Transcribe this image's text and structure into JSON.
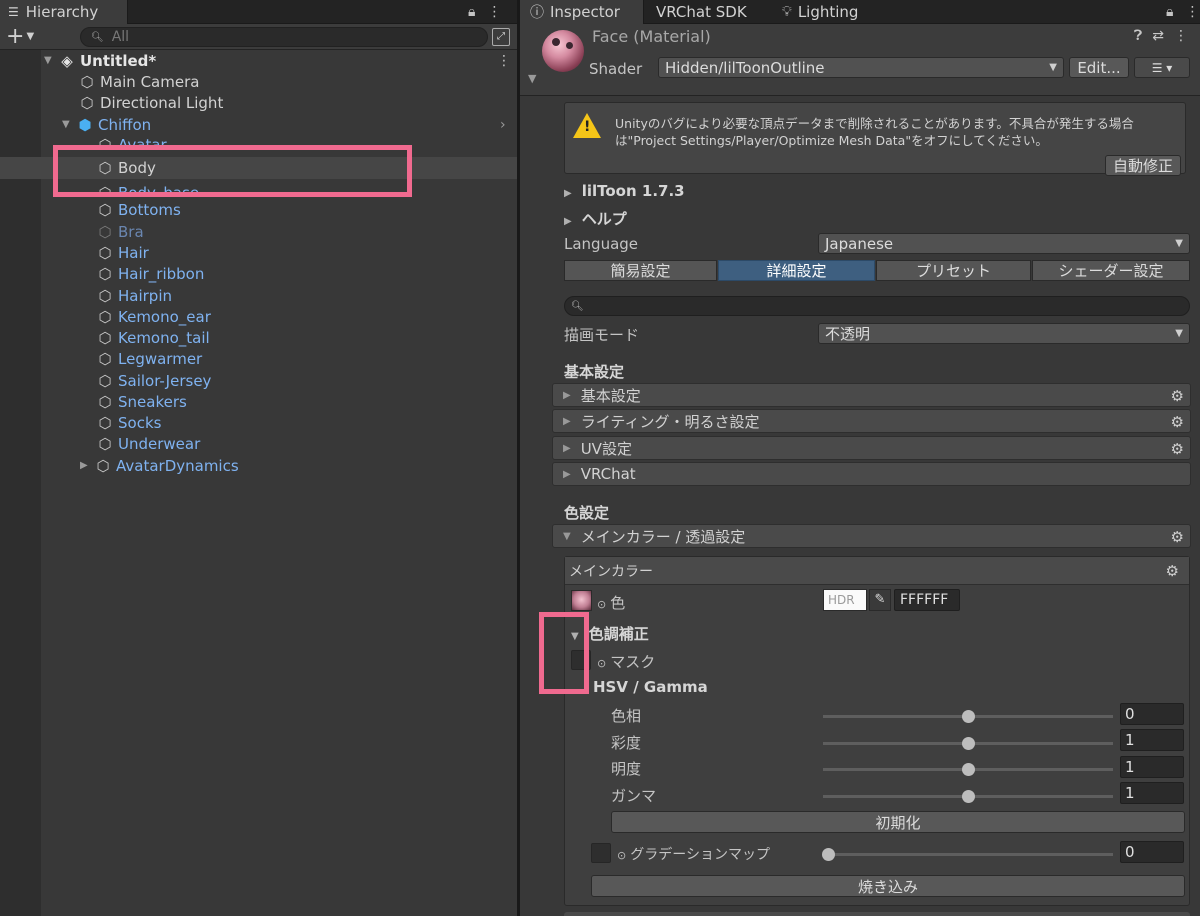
{
  "hierarchy": {
    "tab_label": "Hierarchy",
    "search_placeholder": "All",
    "scene_name": "Untitled*",
    "items": [
      {
        "label": "Main Camera"
      },
      {
        "label": "Directional Light"
      },
      {
        "label": "Chiffon"
      },
      {
        "label": "Avatar"
      },
      {
        "label": "Body"
      },
      {
        "label": "Body_base"
      },
      {
        "label": "Bottoms"
      },
      {
        "label": "Bra"
      },
      {
        "label": "Hair"
      },
      {
        "label": "Hair_ribbon"
      },
      {
        "label": "Hairpin"
      },
      {
        "label": "Kemono_ear"
      },
      {
        "label": "Kemono_tail"
      },
      {
        "label": "Legwarmer"
      },
      {
        "label": "Sailor-Jersey"
      },
      {
        "label": "Sneakers"
      },
      {
        "label": "Socks"
      },
      {
        "label": "Underwear"
      },
      {
        "label": "AvatarDynamics"
      }
    ]
  },
  "inspector": {
    "tabs": [
      {
        "label": "Inspector"
      },
      {
        "label": "VRChat SDK"
      },
      {
        "label": "Lighting"
      }
    ],
    "material_title": "Face (Material)",
    "shader_label": "Shader",
    "shader_value": "Hidden/lilToonOutline",
    "edit_button": "Edit...",
    "warning_text": "Unityのバグにより必要な頂点データまで削除されることがあります。不具合が発生する場合は\"Project Settings/Player/Optimize Mesh Data\"をオフにしてください。",
    "auto_fix_button": "自動修正",
    "version_label": "lilToon 1.7.3",
    "help_label": "ヘルプ",
    "language_label": "Language",
    "language_value": "Japanese",
    "mode_tabs": [
      "簡易設定",
      "詳細設定",
      "プリセット",
      "シェーダー設定"
    ],
    "render_mode_label": "描画モード",
    "render_mode_value": "不透明",
    "basic_section_title": "基本設定",
    "basic_foldouts": [
      "基本設定",
      "ライティング・明るさ設定",
      "UV設定",
      "VRChat"
    ],
    "color_section_title": "色設定",
    "main_color_foldout": "メインカラー / 透過設定",
    "main_color_box_title": "メインカラー",
    "color_label": "色",
    "hdr_label": "HDR",
    "hex_value": "FFFFFF",
    "color_correction_label": "色調補正",
    "mask_label": "マスク",
    "hsv_gamma_label": "HSV / Gamma",
    "sliders": [
      {
        "label": "色相",
        "value": "0"
      },
      {
        "label": "彩度",
        "value": "1"
      },
      {
        "label": "明度",
        "value": "1"
      },
      {
        "label": "ガンマ",
        "value": "1"
      }
    ],
    "reset_button": "初期化",
    "gradation_label": "グラデーションマップ",
    "gradation_value": "0",
    "bake_button": "焼き込み"
  },
  "colors": {
    "highlight": "#f06a8f",
    "prefab_text": "#7fb2f0",
    "active_tab": "#3e5f80"
  }
}
